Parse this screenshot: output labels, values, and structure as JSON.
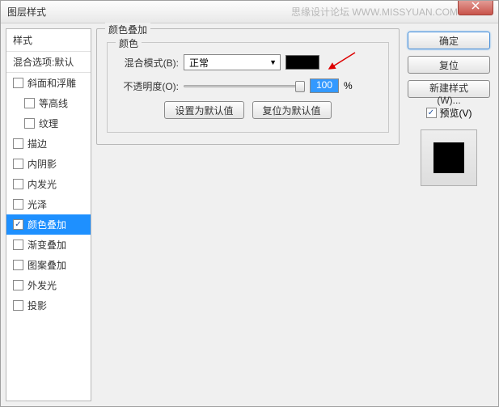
{
  "title": "图层样式",
  "watermark": "思缘设计论坛  WWW.MISSYUAN.COM",
  "leftPanel": {
    "header": "样式",
    "default": "混合选项:默认",
    "items": [
      {
        "label": "斜面和浮雕",
        "checked": false
      },
      {
        "label": "等高线",
        "checked": false,
        "sub": true
      },
      {
        "label": "纹理",
        "checked": false,
        "sub": true
      },
      {
        "label": "描边",
        "checked": false
      },
      {
        "label": "内阴影",
        "checked": false
      },
      {
        "label": "内发光",
        "checked": false
      },
      {
        "label": "光泽",
        "checked": false
      },
      {
        "label": "颜色叠加",
        "checked": true,
        "selected": true
      },
      {
        "label": "渐变叠加",
        "checked": false
      },
      {
        "label": "图案叠加",
        "checked": false
      },
      {
        "label": "外发光",
        "checked": false
      },
      {
        "label": "投影",
        "checked": false
      }
    ]
  },
  "middle": {
    "outerTitle": "颜色叠加",
    "innerTitle": "颜色",
    "blendLabel": "混合模式(B):",
    "blendValue": "正常",
    "opacityLabel": "不透明度(O):",
    "opacityValue": "100",
    "opacityUnit": "%",
    "setDefault": "设置为默认值",
    "resetDefault": "复位为默认值",
    "colorSwatch": "#000000"
  },
  "right": {
    "ok": "确定",
    "reset": "复位",
    "newStyle": "新建样式(W)...",
    "preview": "预览(V)"
  }
}
